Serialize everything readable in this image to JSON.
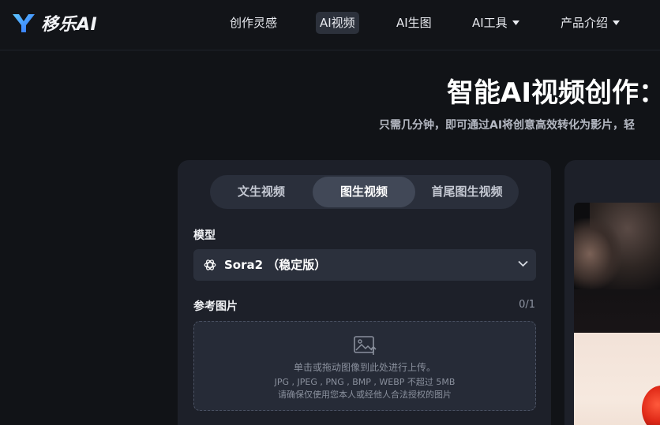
{
  "brand": {
    "name": "移乐AI",
    "colors": {
      "logo_blue": "#3d8bff",
      "logo_cyan": "#5fc8ff"
    }
  },
  "nav": {
    "items": [
      {
        "label": "创作灵感",
        "active": false,
        "has_dropdown": false
      },
      {
        "label": "AI视频",
        "active": true,
        "has_dropdown": false
      },
      {
        "label": "AI生图",
        "active": false,
        "has_dropdown": false
      },
      {
        "label": "AI工具",
        "active": false,
        "has_dropdown": true
      },
      {
        "label": "产品介绍",
        "active": false,
        "has_dropdown": true
      }
    ]
  },
  "hero": {
    "title": "智能AI视频创作：",
    "subtitle": "只需几分钟，即可通过AI将创意高效转化为影片，轻"
  },
  "generator": {
    "tabs": [
      {
        "label": "文生视频",
        "active": false
      },
      {
        "label": "图生视频",
        "active": true
      },
      {
        "label": "首尾图生视频",
        "active": false
      }
    ],
    "model": {
      "label": "模型",
      "selected": "Sora2 （稳定版）",
      "icon": "openai-icon"
    },
    "reference": {
      "label": "参考图片",
      "count": "0/1",
      "upload_icon": "image-upload-icon",
      "hint": "单击或拖动图像到此处进行上传。",
      "formats": "JPG , JPEG , PNG , BMP , WEBP 不超过 5MB",
      "notice": "请确保仅使用您本人或经他人合法授权的图片"
    }
  }
}
